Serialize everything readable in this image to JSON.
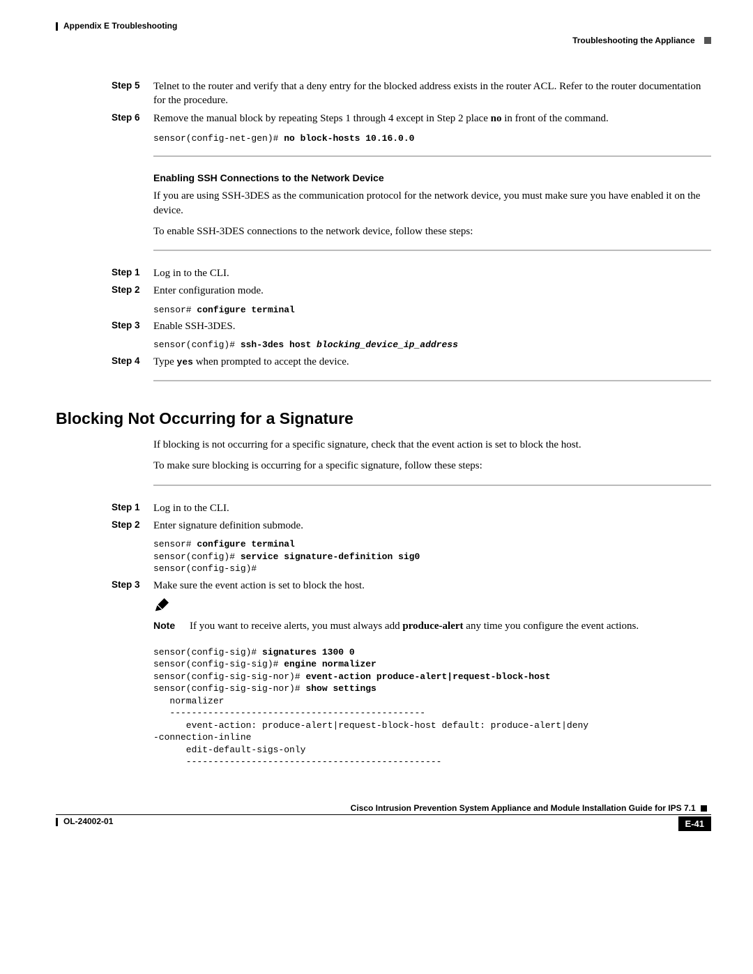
{
  "header": {
    "left": "Appendix E      Troubleshooting",
    "right": "Troubleshooting the Appliance"
  },
  "steps_block1": {
    "step5": {
      "label": "Step 5",
      "text": "Telnet to the router and verify that a deny entry for the blocked address exists in the router ACL. Refer to the router documentation for the procedure."
    },
    "step6": {
      "label": "Step 6",
      "text_before_bold": "Remove the manual block by repeating Steps 1 through 4 except in Step 2 place ",
      "bold": "no",
      "text_after_bold": " in front of the command.",
      "code_prompt": "sensor(config-net-gen)# ",
      "code_cmd": "no block-hosts 10.16.0.0"
    }
  },
  "ssh_section": {
    "heading": "Enabling SSH Connections to the Network Device",
    "p1": "If you are using SSH-3DES as the communication protocol for the network device, you must make sure you have enabled it on the device.",
    "p2": "To enable SSH-3DES connections to the network device, follow these steps:",
    "step1": {
      "label": "Step 1",
      "text": "Log in to the CLI."
    },
    "step2": {
      "label": "Step 2",
      "text": "Enter configuration mode.",
      "code_prompt": "sensor# ",
      "code_cmd": "configure terminal"
    },
    "step3": {
      "label": "Step 3",
      "text": "Enable SSH-3DES.",
      "code_prompt": "sensor(config)# ",
      "code_cmd": "ssh-3des host ",
      "code_arg": "blocking_device_ip_address"
    },
    "step4": {
      "label": "Step 4",
      "text_before": "Type ",
      "code_inline": "yes",
      "text_after": " when prompted to accept the device."
    }
  },
  "blocking_section": {
    "heading": "Blocking Not Occurring for a Signature",
    "p1": "If blocking is not occurring for a specific signature, check that the event action is set to block the host.",
    "p2": "To make sure blocking is occurring for a specific signature, follow these steps:",
    "step1": {
      "label": "Step 1",
      "text": "Log in to the CLI."
    },
    "step2": {
      "label": "Step 2",
      "text": "Enter signature definition submode.",
      "code_l1_p": "sensor# ",
      "code_l1_c": "configure terminal",
      "code_l2_p": "sensor(config)# ",
      "code_l2_c": "service signature-definition sig0",
      "code_l3_p": "sensor(config-sig)# "
    },
    "step3": {
      "label": "Step 3",
      "text": "Make sure the event action is set to block the host.",
      "note_label": "Note",
      "note_before": "If you want to receive alerts, you must always add ",
      "note_bold": "produce-alert",
      "note_after": " any time you configure the event actions.",
      "out_l1_p": "sensor(config-sig)# ",
      "out_l1_c": "signatures 1300 0",
      "out_l2_p": "sensor(config-sig-sig)# ",
      "out_l2_c": "engine normalizer",
      "out_l3_p": "sensor(config-sig-sig-nor)# ",
      "out_l3_c": "event-action produce-alert|request-block-host",
      "out_l4_p": "sensor(config-sig-sig-nor)# ",
      "out_l4_c": "show settings",
      "out_l5": "   normalizer",
      "out_l6": "   -----------------------------------------------",
      "out_l7": "      event-action: produce-alert|request-block-host default: produce-alert|deny",
      "out_l8": "-connection-inline",
      "out_l9": "      edit-default-sigs-only",
      "out_l10": "      -----------------------------------------------"
    }
  },
  "footer": {
    "title": "Cisco Intrusion Prevention System Appliance and Module Installation Guide for IPS 7.1",
    "doc_id": "OL-24002-01",
    "page_num": "E-41"
  }
}
